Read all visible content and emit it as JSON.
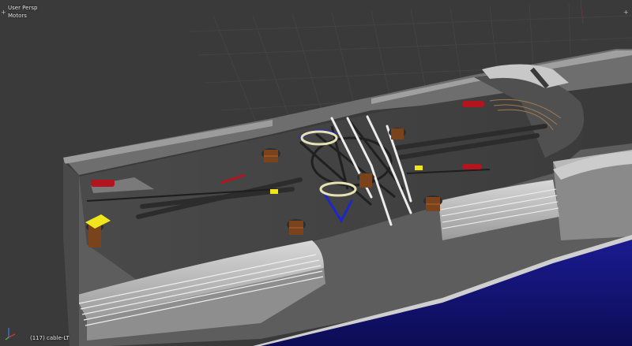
{
  "viewport": {
    "view_name": "User Persp",
    "group_name": "Motors",
    "object_info": "(117) cable-LT",
    "plus_glyph": "+",
    "grid_color": "#454545",
    "background_color": "#3a3a3a"
  },
  "scene": {
    "description_icon": "3d-model-train-car-roof",
    "body_color": "#8c8c8c",
    "blue_stripe_color": "#1a1a8c",
    "accent_red": "#b4141e",
    "accent_yellow": "#f0e61e",
    "accent_blue": "#1e28c8",
    "copper_color": "#8a4a1e"
  },
  "gizmo": {
    "x_color": "#d2343a",
    "y_color": "#5ab43c",
    "z_color": "#3c78d2"
  }
}
